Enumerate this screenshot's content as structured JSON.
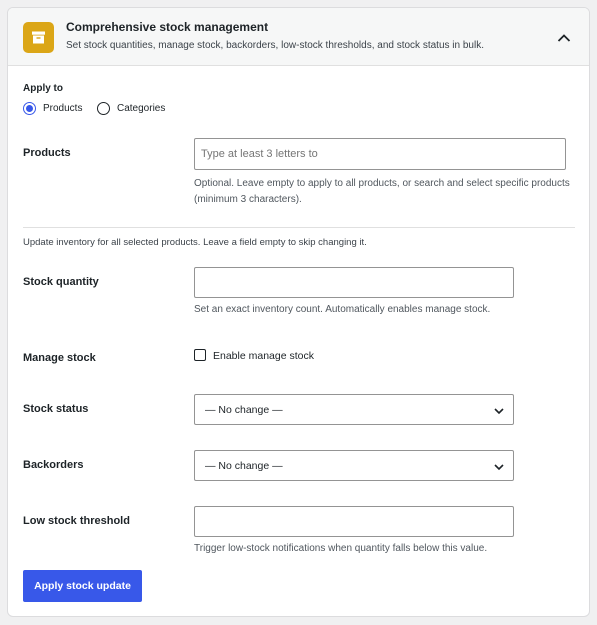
{
  "header": {
    "title": "Comprehensive stock management",
    "subtitle": "Set stock quantities, manage stock, backorders, low-stock thresholds, and stock status in bulk.",
    "icon": "archive-box-icon",
    "collapse_icon": "chevron-up-icon",
    "icon_color": "#dba617"
  },
  "apply_to": {
    "label": "Apply to",
    "options": [
      {
        "label": "Products",
        "checked": true
      },
      {
        "label": "Categories",
        "checked": false
      }
    ]
  },
  "products": {
    "label": "Products",
    "placeholder": "Type at least 3 letters to",
    "help": "Optional. Leave empty to apply to all products, or search and select specific products (minimum 3 characters)."
  },
  "intro": "Update inventory for all selected products. Leave a field empty to skip changing it.",
  "stock_quantity": {
    "label": "Stock quantity",
    "value": "",
    "help": "Set an exact inventory count. Automatically enables manage stock."
  },
  "manage_stock": {
    "label": "Manage stock",
    "checkbox_label": "Enable manage stock",
    "checked": false
  },
  "stock_status": {
    "label": "Stock status",
    "selected": "— No change —"
  },
  "backorders": {
    "label": "Backorders",
    "selected": "— No change —"
  },
  "low_stock": {
    "label": "Low stock threshold",
    "value": "",
    "help": "Trigger low-stock notifications when quantity falls below this value."
  },
  "submit": {
    "label": "Apply stock update",
    "color": "#3858e9"
  }
}
